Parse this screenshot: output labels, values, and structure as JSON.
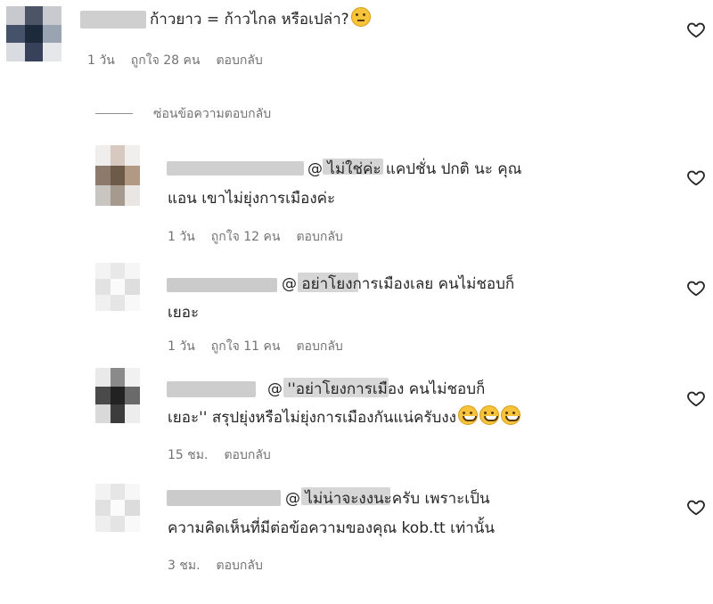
{
  "comments": [
    {
      "id": "main",
      "text_lines": [
        "ก้าวยาว = ก้าวไกล หรือเปล่า?"
      ],
      "emojis_line1": [
        "thinking-face"
      ],
      "time": "1 วัน",
      "likes": "ถูกใจ 28 คน",
      "reply": "ตอบกลับ"
    },
    {
      "id": "r1",
      "text_lines": [
        "@         ไม่ใช่ค่ะ แคปชั่น ปกติ นะ คุณ",
        "แอน เขาไม่ยุ่งการเมืองค่ะ"
      ],
      "time": "1 วัน",
      "likes": "ถูกใจ 12 คน",
      "reply": "ตอบกลับ"
    },
    {
      "id": "r2",
      "text_lines": [
        "@         อย่าโยงการเมืองเลย คนไม่ชอบก็",
        "เยอะ"
      ],
      "time": "1 วัน",
      "likes": "ถูกใจ 11 คน",
      "reply": "ตอบกลับ"
    },
    {
      "id": "r3",
      "text_lines": [
        "@                   ''อย่าโยงการเมือง คนไม่ชอบก็",
        "เยอะ'' สรุปยุ่งหรือไม่ยุ่งการเมืองกันแน่ครับงง"
      ],
      "time": "15 ชม.",
      "reply": "ตอบกลับ"
    },
    {
      "id": "r4",
      "text_lines": [
        "@                 ไม่น่าจะงงนะครับ เพราะเป็น",
        "ความคิดเห็นที่มีต่อข้อความของคุณ kob.tt เท่านั้น"
      ],
      "time": "3 ชม.",
      "reply": "ตอบกลับ"
    }
  ],
  "hide_replies_label": "ซ่อนข้อความตอบกลับ",
  "colors": {
    "text": "#262626",
    "meta": "#737373",
    "blur": "#c9c9c9"
  },
  "icons": {
    "like": "heart-outline-icon",
    "emoji_grin": "grinning-sweat-icon",
    "emoji_think": "thinking-face-icon"
  }
}
